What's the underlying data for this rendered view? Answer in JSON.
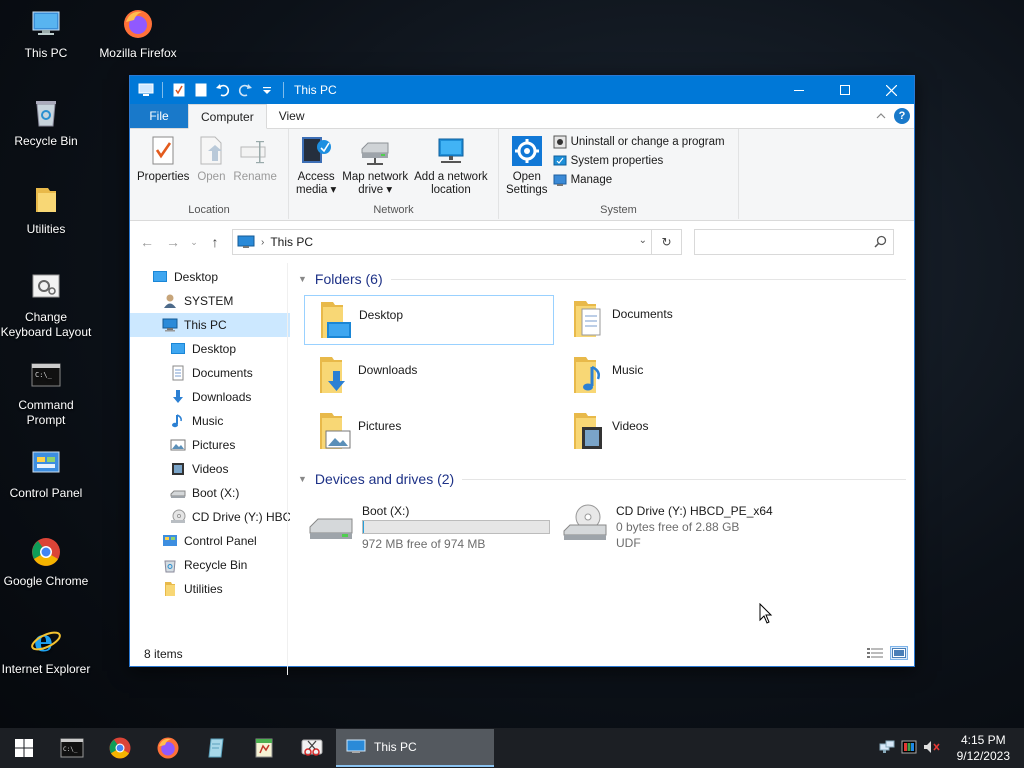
{
  "desktop": {
    "icons": [
      {
        "label": "This PC"
      },
      {
        "label": "Mozilla Firefox"
      },
      {
        "label": "Recycle Bin"
      },
      {
        "label": "Utilities"
      },
      {
        "label": "Change Keyboard Layout"
      },
      {
        "label": "Command Prompt"
      },
      {
        "label": "Control Panel"
      },
      {
        "label": "Google Chrome"
      },
      {
        "label": "Internet Explorer"
      }
    ]
  },
  "window": {
    "title": "This PC",
    "tabs": {
      "file": "File",
      "computer": "Computer",
      "view": "View"
    },
    "ribbon": {
      "location": {
        "label": "Location",
        "properties": "Properties",
        "open": "Open",
        "rename": "Rename"
      },
      "network": {
        "label": "Network",
        "access_media_l1": "Access",
        "access_media_l2": "media",
        "map_drive_l1": "Map network",
        "map_drive_l2": "drive",
        "add_location_l1": "Add a network",
        "add_location_l2": "location"
      },
      "system": {
        "label": "System",
        "open_settings_l1": "Open",
        "open_settings_l2": "Settings",
        "uninstall": "Uninstall or change a program",
        "system_properties": "System properties",
        "manage": "Manage"
      }
    },
    "address": {
      "path": "This PC"
    },
    "search": {
      "placeholder": ""
    },
    "nav_pane": [
      {
        "label": "Desktop"
      },
      {
        "label": "SYSTEM"
      },
      {
        "label": "This PC"
      },
      {
        "label": "Desktop"
      },
      {
        "label": "Documents"
      },
      {
        "label": "Downloads"
      },
      {
        "label": "Music"
      },
      {
        "label": "Pictures"
      },
      {
        "label": "Videos"
      },
      {
        "label": "Boot (X:)"
      },
      {
        "label": "CD Drive (Y:) HBC"
      },
      {
        "label": "Control Panel"
      },
      {
        "label": "Recycle Bin"
      },
      {
        "label": "Utilities"
      }
    ],
    "folders_header": "Folders (6)",
    "folders": [
      {
        "name": "Desktop"
      },
      {
        "name": "Documents"
      },
      {
        "name": "Downloads"
      },
      {
        "name": "Music"
      },
      {
        "name": "Pictures"
      },
      {
        "name": "Videos"
      }
    ],
    "drives_header": "Devices and drives (2)",
    "drives": [
      {
        "name": "Boot (X:)",
        "free": "972 MB free of 974 MB",
        "used_fraction": 0.002
      },
      {
        "name": "CD Drive (Y:) HBCD_PE_x64",
        "free": "0 bytes free of 2.88 GB",
        "fs": "UDF"
      }
    ],
    "status": "8 items"
  },
  "taskbar": {
    "active_window": "This PC",
    "time": "4:15 PM",
    "date": "9/12/2023"
  },
  "colors": {
    "title_blue": "#0078d7",
    "selection": "#cce8ff",
    "group_header": "#1e3287"
  }
}
